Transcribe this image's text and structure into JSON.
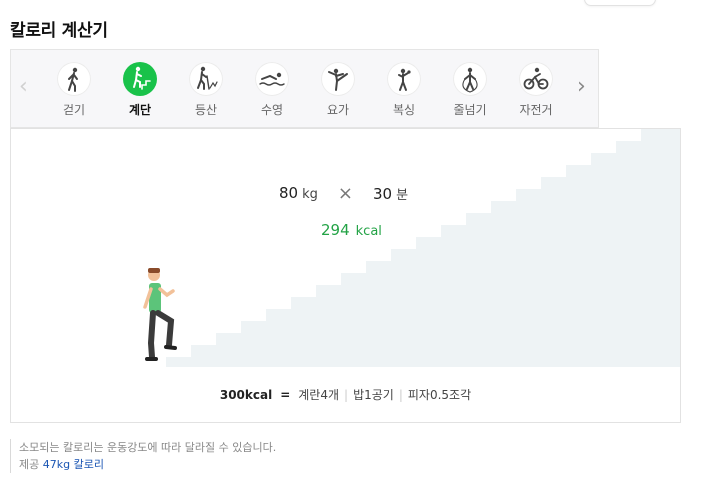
{
  "title": "칼로리 계산기",
  "tabs": [
    {
      "label": "걷기",
      "icon": "walking-icon",
      "active": false
    },
    {
      "label": "계단",
      "icon": "stairs-icon",
      "active": true
    },
    {
      "label": "등산",
      "icon": "hiking-icon",
      "active": false
    },
    {
      "label": "수영",
      "icon": "swimming-icon",
      "active": false
    },
    {
      "label": "요가",
      "icon": "yoga-icon",
      "active": false
    },
    {
      "label": "복싱",
      "icon": "boxing-icon",
      "active": false
    },
    {
      "label": "줄넘기",
      "icon": "jump-rope-icon",
      "active": false
    },
    {
      "label": "자전거",
      "icon": "bicycle-icon",
      "active": false
    }
  ],
  "nav": {
    "prev": "‹",
    "next": "›"
  },
  "calculator": {
    "weight_value": "80",
    "weight_unit": "kg",
    "times_symbol": "×",
    "duration_value": "30",
    "duration_unit": "분",
    "result_value": "294",
    "result_unit": "kcal"
  },
  "equivalent": {
    "base": "300kcal",
    "equals": "=",
    "items": [
      "계란4개",
      "밥1공기",
      "피자0.5조각"
    ]
  },
  "notes": {
    "disclaimer": "소모되는 칼로리는 운동강도에 따라 달라질 수 있습니다.",
    "provider_prefix": "제공",
    "provider_link": "47kg 칼로리"
  },
  "colors": {
    "accent": "#19c24a",
    "result": "#23a346",
    "stairs": "#eef3f5"
  }
}
